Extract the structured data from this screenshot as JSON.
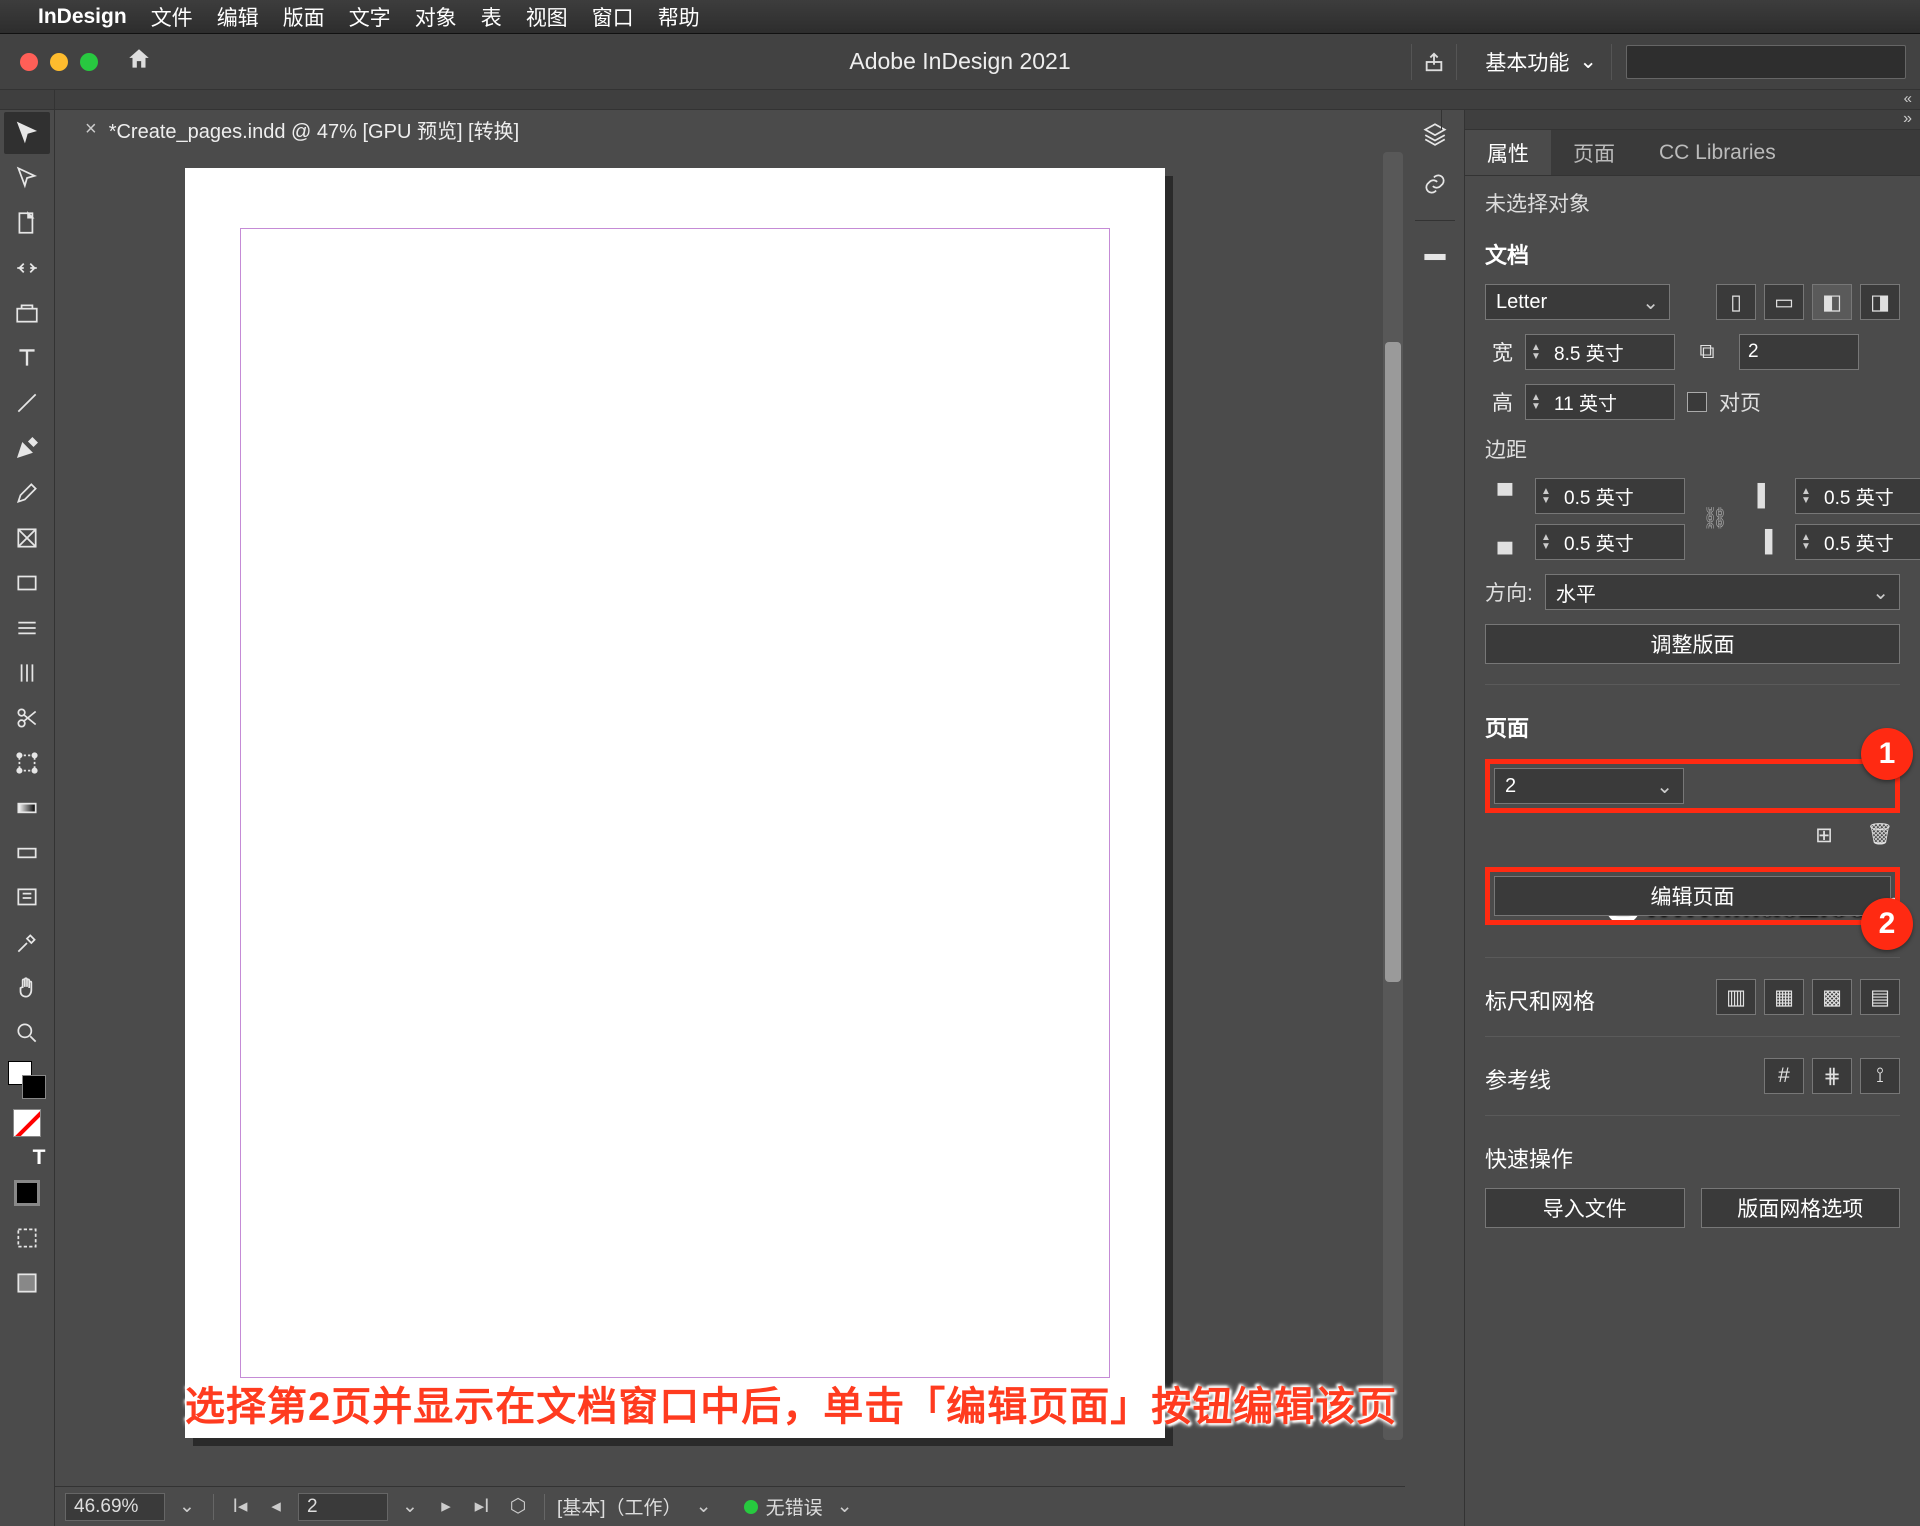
{
  "menubar": {
    "app": "InDesign",
    "items": [
      "文件",
      "编辑",
      "版面",
      "文字",
      "对象",
      "表",
      "视图",
      "窗口",
      "帮助"
    ]
  },
  "titlebar": {
    "title": "Adobe InDesign 2021",
    "workspace": "基本功能"
  },
  "document": {
    "tab_label": "*Create_pages.indd @ 47% [GPU 预览] [转换]"
  },
  "status": {
    "zoom": "46.69%",
    "page": "2",
    "profile": "[基本]（工作）",
    "errors": "无错误"
  },
  "panel": {
    "tabs": {
      "properties": "属性",
      "pages": "页面",
      "cc": "CC Libraries"
    },
    "no_selection": "未选择对象",
    "doc_section": "文档",
    "preset": "Letter",
    "width_label": "宽",
    "width_val": "8.5 英寸",
    "height_label": "高",
    "height_val": "11 英寸",
    "pages_count": "2",
    "facing_label": "对页",
    "margins_label": "边距",
    "m_top": "0.5 英寸",
    "m_bottom": "0.5 英寸",
    "m_left": "0.5 英寸",
    "m_right": "0.5 英寸",
    "orient_label": "方向:",
    "orient_value": "水平",
    "adjust_layout": "调整版面",
    "page_section": "页面",
    "page_dd": "2",
    "edit_page": "编辑页面",
    "rulers_label": "标尺和网格",
    "guides_label": "参考线",
    "quick_label": "快速操作",
    "import_btn": "导入文件",
    "grid_opts_btn": "版面网格选项"
  },
  "callouts": {
    "one": "1",
    "two": "2"
  },
  "watermark": "www.MacZ.com",
  "annotation": "选择第2页并显示在文档窗口中后，单击「编辑页面」按钮编辑该页"
}
